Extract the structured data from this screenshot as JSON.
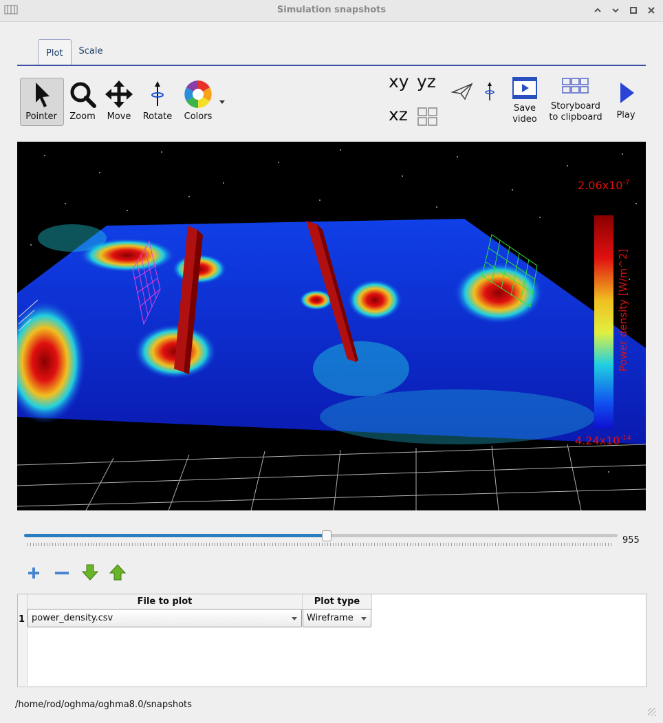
{
  "window": {
    "title": "Simulation snapshots"
  },
  "tabs": [
    {
      "label": "Plot"
    },
    {
      "label": "Scale"
    }
  ],
  "toolbar": {
    "pointer": "Pointer",
    "zoom": "Zoom",
    "move": "Move",
    "rotate": "Rotate",
    "colors": "Colors",
    "view_xy": "xy",
    "view_yz": "yz",
    "view_xz": "xz",
    "save_video": "Save\nvideo",
    "storyboard": "Storyboard\nto clipboard",
    "play": "Play"
  },
  "plot": {
    "colorbar_max": "2.06x10",
    "colorbar_max_exp": "-7",
    "colorbar_min": "4.24x10",
    "colorbar_min_exp": "-14",
    "colorbar_label": "Power density [W/m^2]"
  },
  "slider": {
    "value": "955",
    "fraction": 0.509
  },
  "table": {
    "columns": [
      "File to plot",
      "Plot type"
    ],
    "rows": [
      {
        "index": "1",
        "file": "power_density.csv",
        "plot_type": "Wireframe"
      }
    ]
  },
  "status": {
    "path": "/home/rod/oghma/oghma8.0/snapshots"
  },
  "colors": {
    "accent": "#3b4fa6",
    "slider_fill": "#2a7fc0",
    "colorbar_text": "#e01010"
  }
}
